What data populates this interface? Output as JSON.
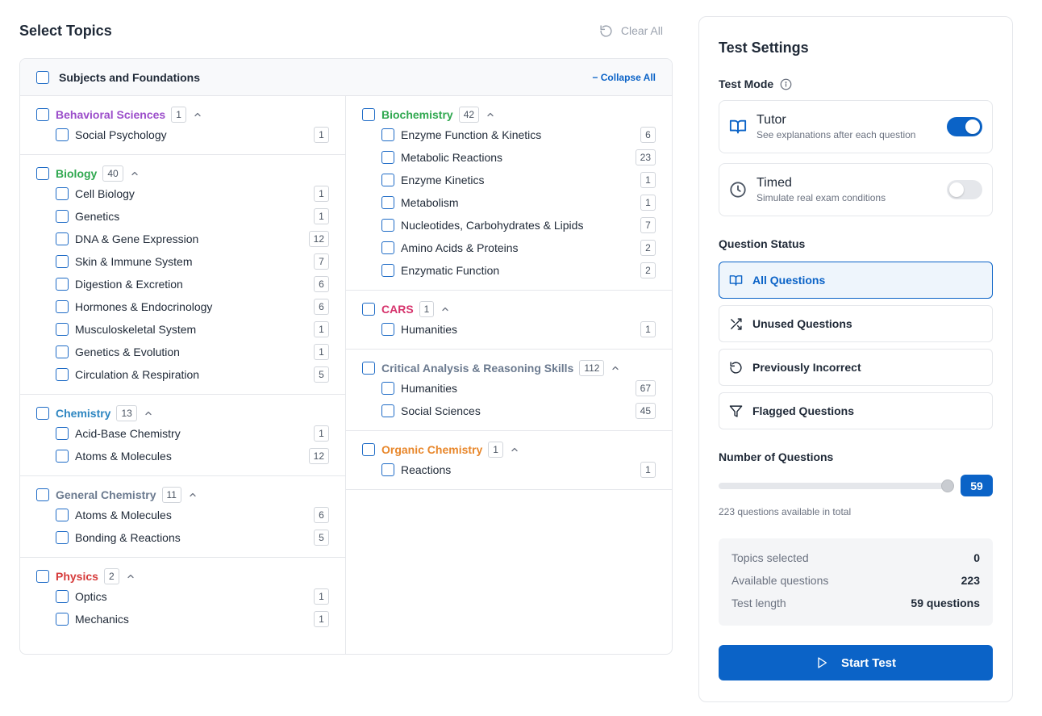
{
  "header": {
    "title": "Select Topics",
    "clear_all_label": "Clear All"
  },
  "topics_card": {
    "header_label": "Subjects and Foundations",
    "collapse_all_label": "− Collapse All"
  },
  "left_groups": [
    {
      "title": "Behavioral Sciences",
      "count": "1",
      "color": "#9b4dca",
      "items": [
        {
          "name": "Social Psychology",
          "count": "1"
        }
      ]
    },
    {
      "title": "Biology",
      "count": "40",
      "color": "#2fa84f",
      "items": [
        {
          "name": "Cell Biology",
          "count": "1"
        },
        {
          "name": "Genetics",
          "count": "1"
        },
        {
          "name": "DNA & Gene Expression",
          "count": "12"
        },
        {
          "name": "Skin & Immune System",
          "count": "7"
        },
        {
          "name": "Digestion & Excretion",
          "count": "6"
        },
        {
          "name": "Hormones & Endocrinology",
          "count": "6"
        },
        {
          "name": "Musculoskeletal System",
          "count": "1"
        },
        {
          "name": "Genetics & Evolution",
          "count": "1"
        },
        {
          "name": "Circulation & Respiration",
          "count": "5"
        }
      ]
    },
    {
      "title": "Chemistry",
      "count": "13",
      "color": "#2e86c1",
      "items": [
        {
          "name": "Acid-Base Chemistry",
          "count": "1"
        },
        {
          "name": "Atoms & Molecules",
          "count": "12"
        }
      ]
    },
    {
      "title": "General Chemistry",
      "count": "11",
      "color": "#6b7a8f",
      "items": [
        {
          "name": "Atoms & Molecules",
          "count": "6"
        },
        {
          "name": "Bonding & Reactions",
          "count": "5"
        }
      ]
    },
    {
      "title": "Physics",
      "count": "2",
      "color": "#d63b3b",
      "items": [
        {
          "name": "Optics",
          "count": "1"
        },
        {
          "name": "Mechanics",
          "count": "1"
        }
      ]
    }
  ],
  "right_groups": [
    {
      "title": "Biochemistry",
      "count": "42",
      "color": "#2fa84f",
      "items": [
        {
          "name": "Enzyme Function & Kinetics",
          "count": "6"
        },
        {
          "name": "Metabolic Reactions",
          "count": "23"
        },
        {
          "name": "Enzyme Kinetics",
          "count": "1"
        },
        {
          "name": "Metabolism",
          "count": "1"
        },
        {
          "name": "Nucleotides, Carbohydrates & Lipids",
          "count": "7"
        },
        {
          "name": "Amino Acids & Proteins",
          "count": "2"
        },
        {
          "name": "Enzymatic Function",
          "count": "2"
        }
      ]
    },
    {
      "title": "CARS",
      "count": "1",
      "color": "#d6336c",
      "items": [
        {
          "name": "Humanities",
          "count": "1"
        }
      ]
    },
    {
      "title": "Critical Analysis & Reasoning Skills",
      "count": "112",
      "color": "#6b7a8f",
      "items": [
        {
          "name": "Humanities",
          "count": "67"
        },
        {
          "name": "Social Sciences",
          "count": "45"
        }
      ]
    },
    {
      "title": "Organic Chemistry",
      "count": "1",
      "color": "#e8872b",
      "items": [
        {
          "name": "Reactions",
          "count": "1"
        }
      ]
    }
  ],
  "settings": {
    "title": "Test Settings",
    "test_mode_label": "Test Mode",
    "tutor": {
      "title": "Tutor",
      "subtitle": "See explanations after each question",
      "enabled": true
    },
    "timed": {
      "title": "Timed",
      "subtitle": "Simulate real exam conditions",
      "enabled": false
    },
    "question_status_label": "Question Status",
    "status_options": [
      {
        "label": "All Questions",
        "icon": "book-open-icon",
        "active": true
      },
      {
        "label": "Unused Questions",
        "icon": "shuffle-icon",
        "active": false
      },
      {
        "label": "Previously Incorrect",
        "icon": "rotate-ccw-icon",
        "active": false
      },
      {
        "label": "Flagged Questions",
        "icon": "filter-icon",
        "active": false
      }
    ],
    "num_questions_label": "Number of Questions",
    "num_questions_value": "59",
    "slider_fraction": 0.264,
    "available_note": "223 questions available in total",
    "summary": [
      {
        "key": "Topics selected",
        "value": "0"
      },
      {
        "key": "Available questions",
        "value": "223"
      },
      {
        "key": "Test length",
        "value": "59 questions"
      }
    ],
    "start_label": "Start Test",
    "accent_color": "#0b63c7"
  }
}
